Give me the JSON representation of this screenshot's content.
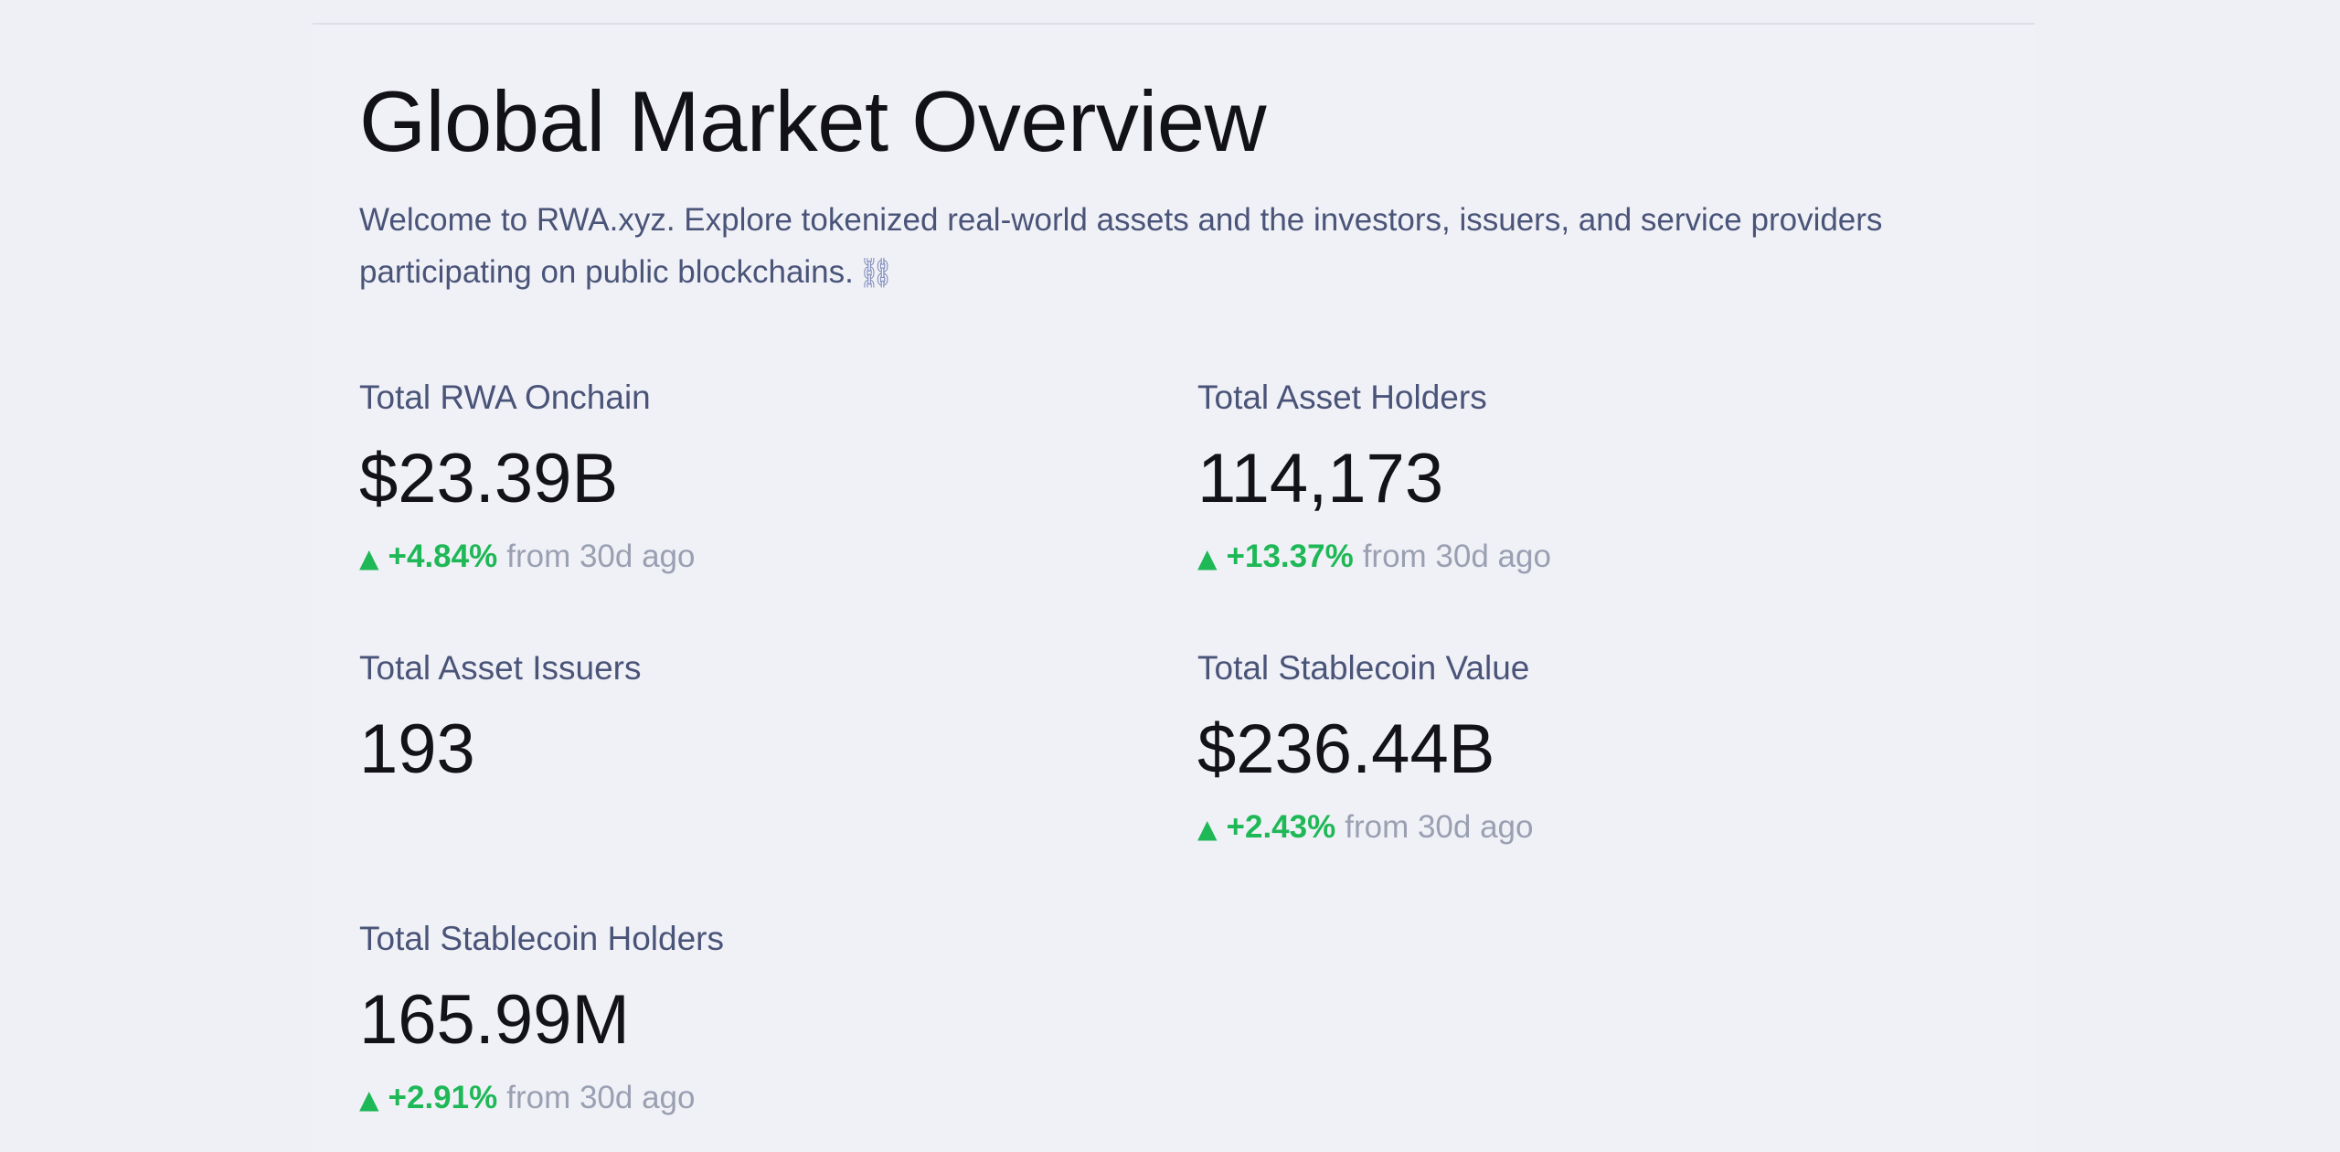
{
  "overview": {
    "title": "Global Market Overview",
    "intro_line1": "Welcome to RWA.xyz. Explore tokenized real-world assets and the investors, issuers, and service providers",
    "intro_line2": "participating on public blockchains.",
    "link_icon": "⛓"
  },
  "stats": [
    {
      "label": "Total RWA Onchain",
      "value": "$23.39B",
      "arrow": "▲",
      "change": "+4.84%",
      "suffix": "from 30d ago"
    },
    {
      "label": "Total Asset Holders",
      "value": "114,173",
      "arrow": "▲",
      "change": "+13.37%",
      "suffix": "from 30d ago"
    },
    {
      "label": "Total Asset Issuers",
      "value": "193"
    },
    {
      "label": "Total Stablecoin Value",
      "value": "$236.44B",
      "arrow": "▲",
      "change": "+2.43%",
      "suffix": "from 30d ago"
    },
    {
      "label": "Total Stablecoin Holders",
      "value": "165.99M",
      "arrow": "▲",
      "change": "+2.91%",
      "suffix": "from 30d ago"
    }
  ],
  "colors": {
    "background": "#eef0f6",
    "positive_change": "#1fb857",
    "label_text": "#4a5478",
    "muted_text": "#9aa0b2"
  }
}
